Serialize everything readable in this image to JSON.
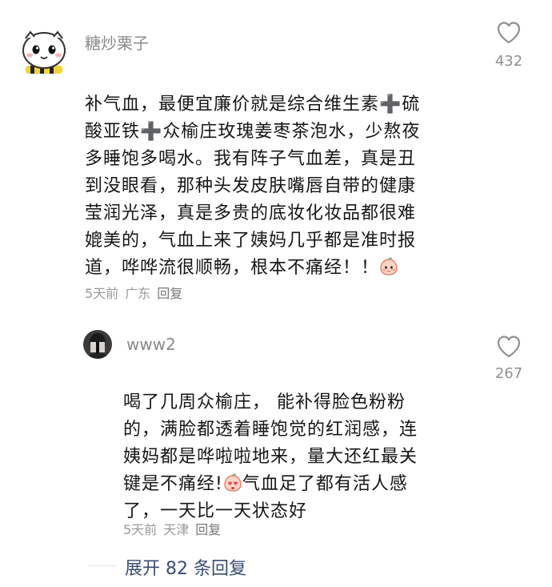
{
  "comments": [
    {
      "username": "糖炒栗子",
      "text": "补气血，最便宜廉价就是综合维生素➕硫\n酸亚铁➕众榆庄玫瑰姜枣茶泡水，少熬夜\n多睡饱多喝水。我有阵子气血差，真是丑\n到没眼看，那种头发皮肤嘴唇自带的健康\n莹润光泽，真是多贵的底妆化妆品都很难\n媲美的，气血上来了姨妈几乎都是准时报\n道，哗哗流很顺畅，根本不痛经！！",
      "time": "5天前",
      "location": "广东",
      "reply": "回复",
      "likes": "432",
      "emoji": "smiling-peach-emoji"
    },
    {
      "username": "www2",
      "text_part1": "喝了几周众榆庄， 能补得脸色粉粉\n的，满脸都透着睡饱觉的红润感，连\n姨妈都是哗啦啦地来，量大还红最关\n键是不痛经!",
      "text_part2": "气血足了都有活人感\n了，一天比一天状态好",
      "time": "5天前",
      "location": "天津",
      "reply": "回复",
      "likes": "267",
      "emoji": "peach-heart-eyes-emoji"
    }
  ],
  "expand_label": "展开 82 条回复"
}
